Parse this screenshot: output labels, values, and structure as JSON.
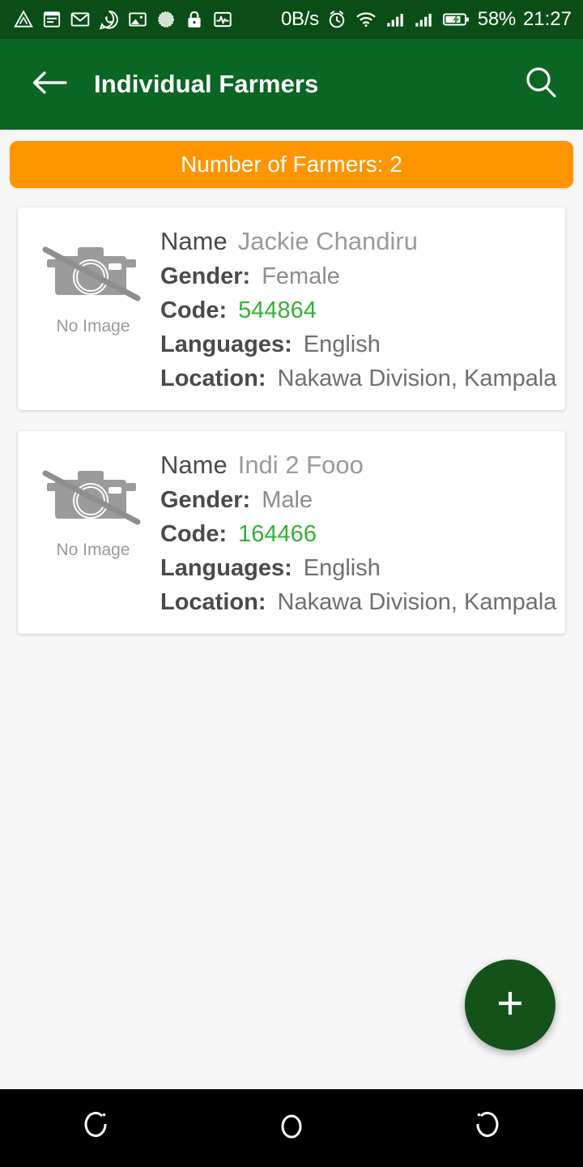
{
  "status_bar": {
    "left_icons": [
      "triangle-alert-icon",
      "notes-icon",
      "gmail-icon",
      "whatsapp-icon",
      "gallery-icon",
      "circle-dotted-icon",
      "lock-icon",
      "activity-pulse-icon"
    ],
    "network_speed": "0B/s",
    "right_icons": [
      "alarm-icon",
      "wifi-icon",
      "signal-icon-1",
      "signal-icon-2",
      "battery-charging-icon"
    ],
    "battery_percent": "58%",
    "clock": "21:27"
  },
  "app_bar": {
    "back_icon": "arrow-left-icon",
    "title": "Individual Farmers",
    "search_icon": "search-icon"
  },
  "banner": {
    "text": "Number of Farmers: 2"
  },
  "labels": {
    "name": "Name",
    "gender": "Gender:",
    "code": "Code:",
    "languages": "Languages:",
    "location": "Location:",
    "no_image": "No Image"
  },
  "farmers": [
    {
      "name": "Jackie Chandiru",
      "gender": "Female",
      "code": "544864",
      "languages": "English",
      "location": "Nakawa Division, Kampala",
      "photo": "No Image"
    },
    {
      "name": "Indi 2 Fooo",
      "gender": "Male",
      "code": "164466",
      "languages": "English",
      "location": "Nakawa Division, Kampala",
      "photo": "No Image"
    }
  ],
  "fab": {
    "icon": "plus-icon",
    "label": "+"
  },
  "nav_bar": {
    "recents_icon": "recents-icon",
    "home_icon": "home-circle-icon",
    "back_icon": "back-arc-icon"
  },
  "colors": {
    "status_bar": "#0b4d16",
    "app_bar": "#0a6623",
    "banner": "#ff9500",
    "code_green": "#35b135",
    "fab": "#14521a",
    "page_bg": "#f7f7f7",
    "card_bg": "#ffffff",
    "nav_bar": "#000000"
  }
}
